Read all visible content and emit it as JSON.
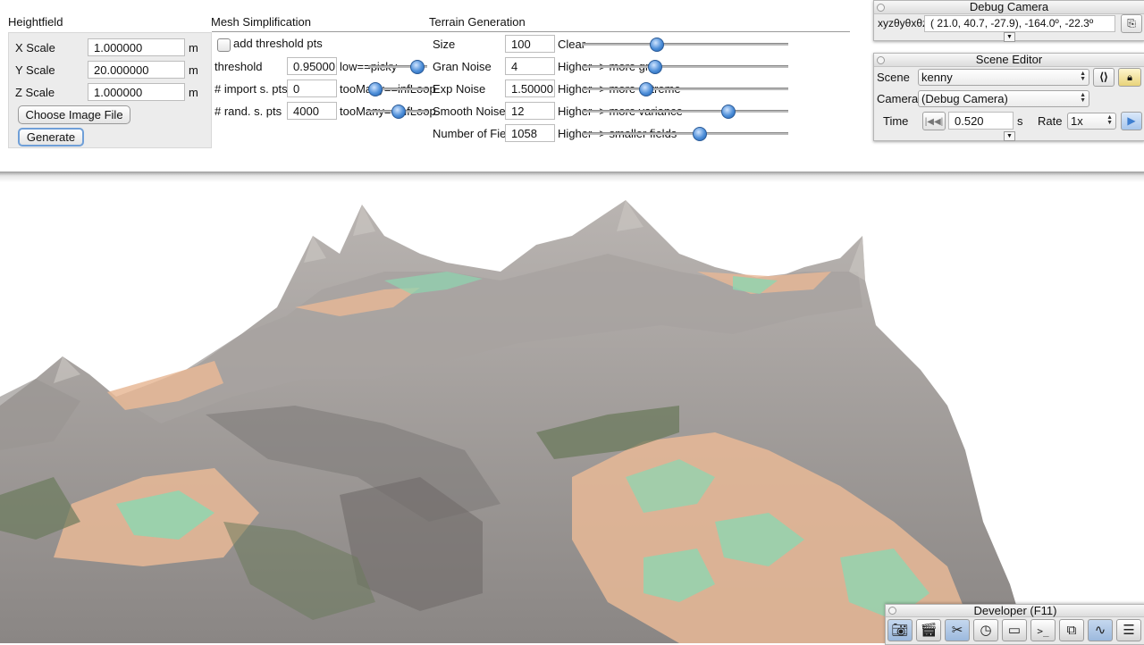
{
  "heightfield": {
    "title": "Heightfield",
    "x_scale": {
      "label": "X Scale",
      "value": "1.000000",
      "unit": "m"
    },
    "y_scale": {
      "label": "Y Scale",
      "value": "20.000000",
      "unit": "m"
    },
    "z_scale": {
      "label": "Z Scale",
      "value": "1.000000",
      "unit": "m"
    },
    "choose_button": "Choose Image File",
    "generate_button": "Generate"
  },
  "mesh": {
    "title": "Mesh Simplification",
    "add_threshold_label": "add threshold pts",
    "threshold": {
      "label": "threshold",
      "value": "0.95000",
      "hint": "low==picky"
    },
    "import_pts": {
      "label": "# import s. pts",
      "value": "0",
      "hint": "tooMany==infLoop"
    },
    "rand_pts": {
      "label": "# rand. s. pts",
      "value": "4000",
      "hint": "tooMany==infLoop"
    }
  },
  "terrain": {
    "title": "Terrain Generation",
    "size": {
      "label": "Size",
      "value": "100",
      "hint": "Clear",
      "slider": 0.36
    },
    "gran_noise": {
      "label": "Gran Noise",
      "value": "4",
      "hint": "Higher -> more gran",
      "slider": 0.35
    },
    "exp_noise": {
      "label": "Exp Noise",
      "value": "1.50000",
      "hint": "Higher -> more extreme",
      "slider": 0.31
    },
    "smooth_noise": {
      "label": "Smooth Noise",
      "value": "12",
      "hint": "Higher -> more variance",
      "slider": 0.71
    },
    "num_fields": {
      "label": "Number of Fields",
      "value": "1058",
      "hint": "Higher -> smaller fields",
      "slider": 0.57
    }
  },
  "debug_camera": {
    "title": "Debug Camera",
    "xyz_label": "xyzθyθxθz",
    "value": "( 21.0,  40.7, -27.9), -164.0º, -22.3º"
  },
  "scene_editor": {
    "title": "Scene Editor",
    "scene_label": "Scene",
    "scene_value": "kenny",
    "camera_label": "Camera",
    "camera_value": "(Debug Camera)",
    "time_label": "Time",
    "time_value": "0.520",
    "time_unit": "s",
    "rate_label": "Rate",
    "rate_value": "1x"
  },
  "developer": {
    "title": "Developer (F11)",
    "tools": [
      "camera-icon",
      "clapperboard-icon",
      "tools-icon",
      "clock-icon",
      "note-icon",
      "terminal-icon",
      "windows-icon",
      "monitor-icon",
      "document-icon"
    ]
  },
  "colors": {
    "accent": "#4d8ed8",
    "rock": "#8f8b89",
    "sand": "#e8b896",
    "grass": "#8fd6b0",
    "moss": "#6b7a5c"
  }
}
